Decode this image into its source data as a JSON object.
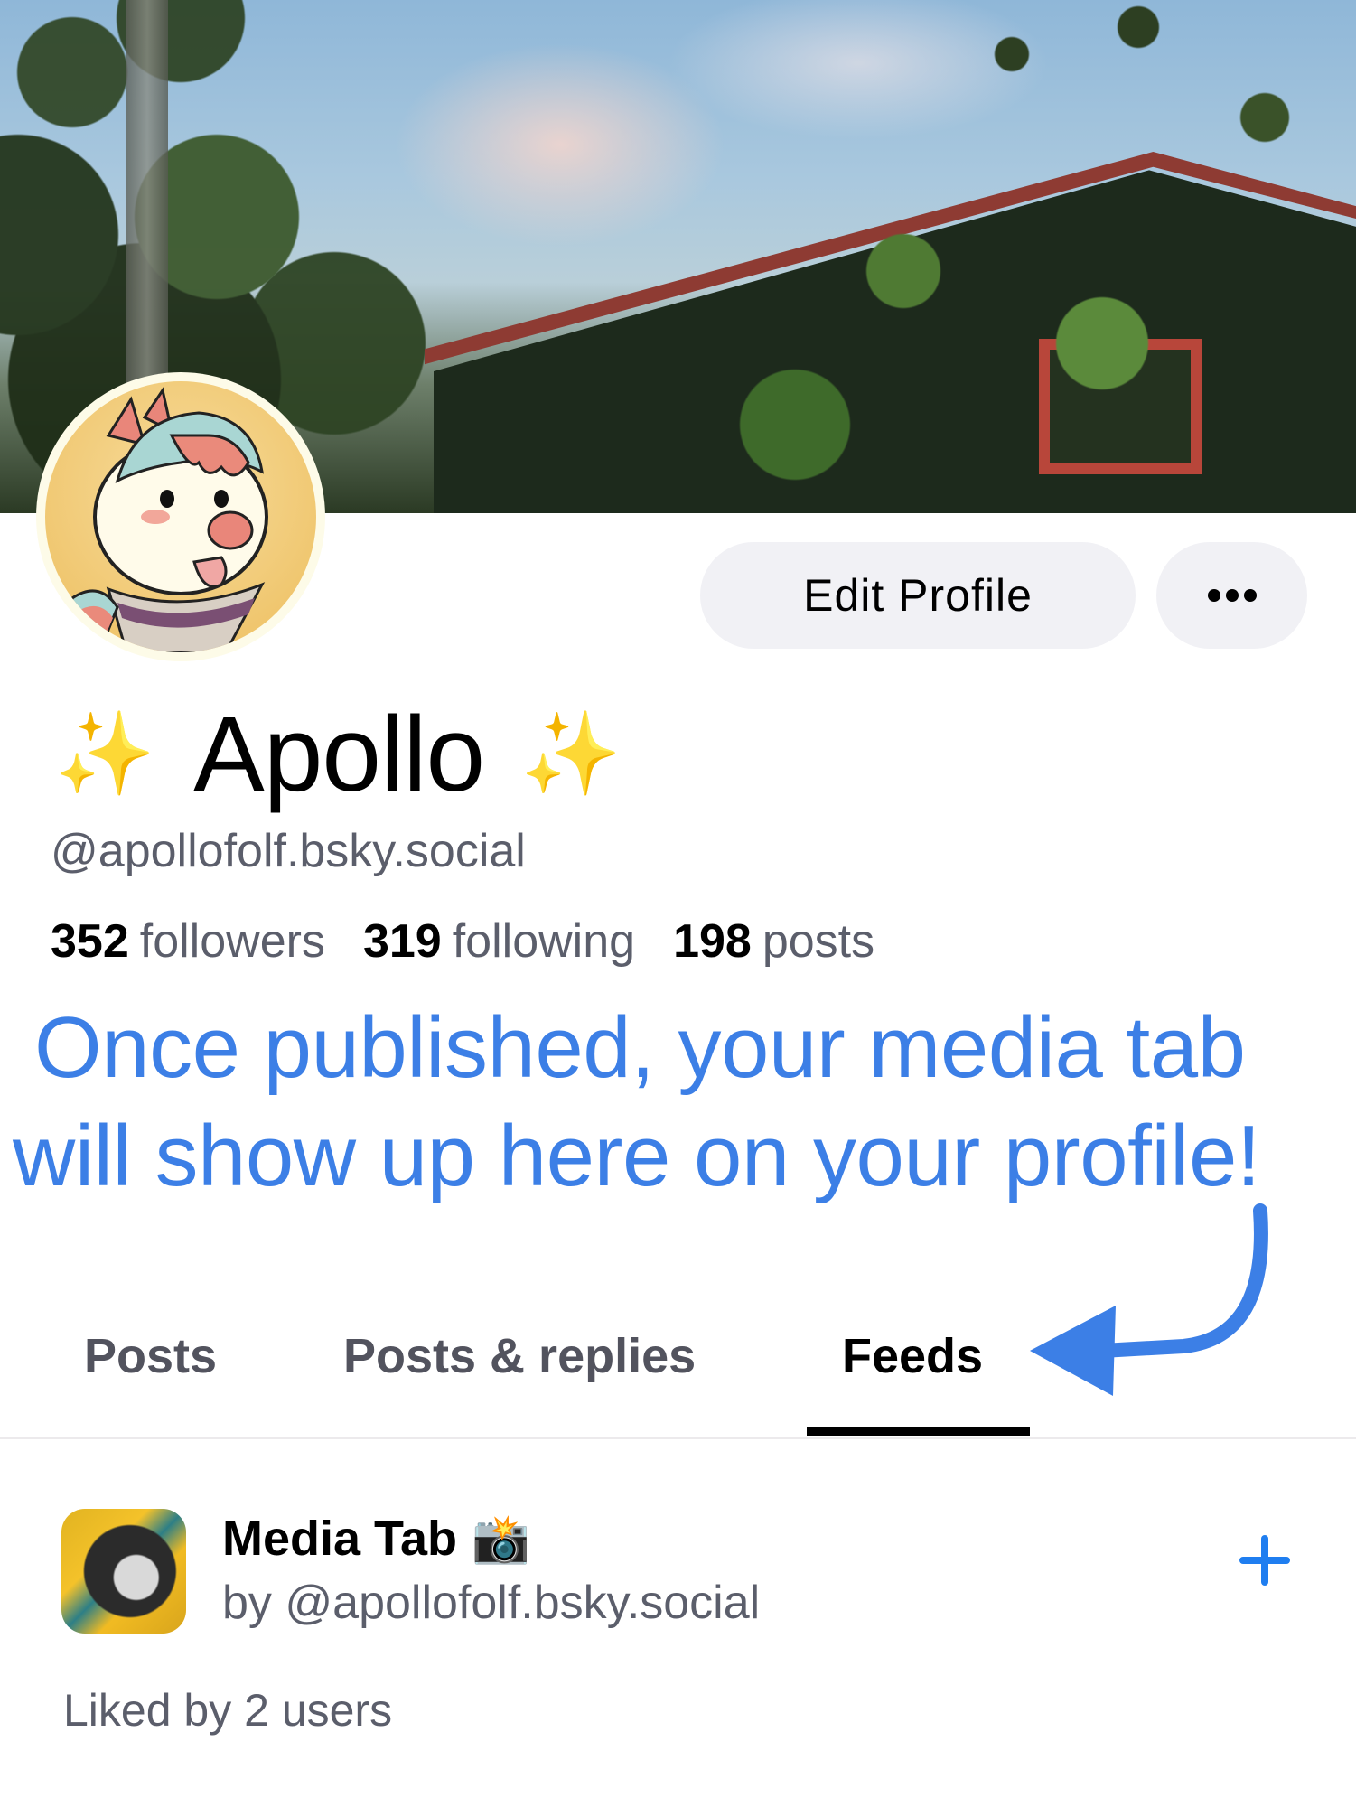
{
  "profile": {
    "display_name": "Apollo",
    "name_prefix_emoji": "✨",
    "name_suffix_emoji": "✨",
    "handle": "@apollofolf.bsky.social",
    "stats": [
      {
        "count": "352",
        "label": "followers"
      },
      {
        "count": "319",
        "label": "following"
      },
      {
        "count": "198",
        "label": "posts"
      }
    ]
  },
  "actions": {
    "edit_profile_label": "Edit Profile",
    "more_icon": "ellipsis-icon"
  },
  "annotation": {
    "line1": "Once published, your media tab",
    "line2": "will show up here on your profile!",
    "color": "#3c7fe6"
  },
  "tabs": [
    {
      "label": "Posts",
      "active": false
    },
    {
      "label": "Posts & replies",
      "active": false
    },
    {
      "label": "Feeds",
      "active": true
    }
  ],
  "feeds": [
    {
      "title": "Media Tab",
      "title_emoji": "📸",
      "author": "by @apollofolf.bsky.social",
      "likes": "Liked by 2 users",
      "action_icon": "plus-icon"
    }
  ],
  "colors": {
    "accent": "#1f7ef0",
    "button_bg": "#f1f1f5",
    "secondary_text": "#5b5e6b"
  }
}
